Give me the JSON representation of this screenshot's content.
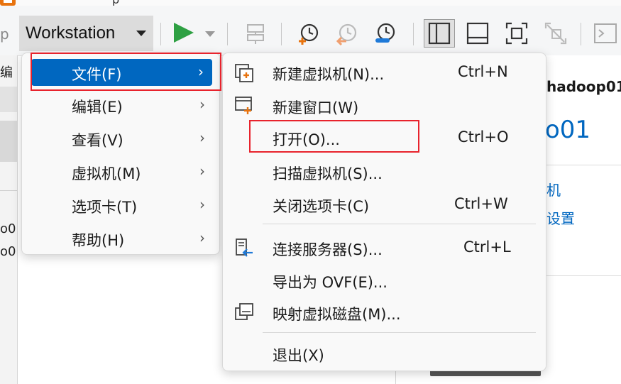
{
  "title_fragment": "p",
  "toolbar": {
    "left_fragment": "p",
    "workstation_label": "Workstation",
    "icons": [
      "play-icon",
      "dropdown-icon",
      "send-ctrl-alt-del-icon",
      "snapshot-icon",
      "revert-snapshot-icon",
      "snapshot-manager-icon",
      "library-view-icon",
      "console-view-icon",
      "fullscreen-icon",
      "unity-icon",
      "terminal-icon"
    ]
  },
  "background": {
    "left_fragments": [
      "编",
      "o0",
      "o0"
    ],
    "vm_header": "hadoop01",
    "vm_title": "o01",
    "link1": "机",
    "link2": "设置"
  },
  "main_menu": {
    "items": [
      {
        "label": "文件(F)",
        "highlighted": true
      },
      {
        "label": "编辑(E)"
      },
      {
        "label": "查看(V)"
      },
      {
        "label": "虚拟机(M)"
      },
      {
        "label": "选项卡(T)"
      },
      {
        "label": "帮助(H)"
      }
    ],
    "arrow": "›"
  },
  "file_menu": {
    "items": [
      {
        "label": "新建虚拟机(N)...",
        "shortcut": "Ctrl+N",
        "icon": "new-vm-icon"
      },
      {
        "label": "新建窗口(W)",
        "shortcut": "",
        "icon": "new-window-icon"
      },
      {
        "label": "打开(O)...",
        "shortcut": "Ctrl+O",
        "icon": ""
      },
      {
        "label": "扫描虚拟机(S)...",
        "shortcut": "",
        "icon": ""
      },
      {
        "label": "关闭选项卡(C)",
        "shortcut": "Ctrl+W",
        "icon": ""
      },
      {
        "label": "连接服务器(S)...",
        "shortcut": "Ctrl+L",
        "icon": "connect-server-icon"
      },
      {
        "label": "导出为 OVF(E)...",
        "shortcut": "",
        "icon": ""
      },
      {
        "label": "映射虚拟磁盘(M)...",
        "shortcut": "",
        "icon": "map-disk-icon"
      },
      {
        "label": "退出(X)",
        "shortcut": "",
        "icon": ""
      }
    ]
  },
  "colors": {
    "highlight": "#0067c0",
    "annotation_red": "#e8232d",
    "play_green": "#2ea043",
    "link_blue": "#0067c0",
    "snapshot_orange": "#e8730e"
  }
}
